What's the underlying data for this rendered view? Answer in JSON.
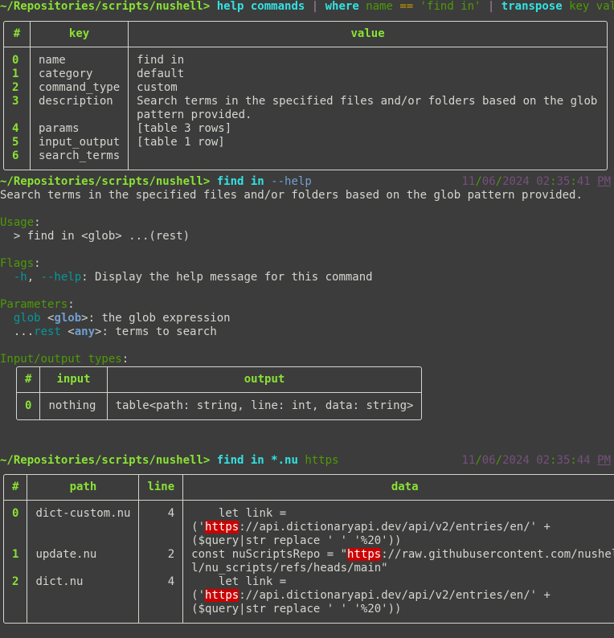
{
  "prompt": "~/Repositories/scripts/nushell>",
  "commands": [
    {
      "parts": [
        {
          "text": "help commands",
          "cls": "cmd"
        },
        {
          "text": " | ",
          "cls": "pipe"
        },
        {
          "text": "where",
          "cls": "kw"
        },
        {
          "text": " name ",
          "cls": "arg"
        },
        {
          "text": "==",
          "cls": "op"
        },
        {
          "text": " 'find in' ",
          "cls": "arg"
        },
        {
          "text": "| ",
          "cls": "pipe"
        },
        {
          "text": "transpose",
          "cls": "kw"
        },
        {
          "text": " key value",
          "cls": "arg"
        }
      ]
    },
    {
      "parts": [
        {
          "text": "find in ",
          "cls": "cmd"
        },
        {
          "text": "--help",
          "cls": "flag"
        }
      ],
      "timestamp": {
        "month": "11",
        "day": "06",
        "year": "2024",
        "h": "02",
        "m": "35",
        "s": "41",
        "ampm": "PM"
      }
    },
    {
      "parts": [
        {
          "text": "find in *.nu ",
          "cls": "cmd"
        },
        {
          "text": "https",
          "cls": "arg"
        }
      ],
      "timestamp": {
        "month": "11",
        "day": "06",
        "year": "2024",
        "h": "02",
        "m": "35",
        "s": "44",
        "ampm": "PM"
      }
    }
  ],
  "transpose_table": {
    "headers": [
      "#",
      "key",
      "value"
    ],
    "rows": [
      {
        "idx": "0",
        "key": "name",
        "value": "find in"
      },
      {
        "idx": "1",
        "key": "category",
        "value": "default"
      },
      {
        "idx": "2",
        "key": "command_type",
        "value": "custom"
      },
      {
        "idx": "3",
        "key": "description",
        "value": "Search terms in the specified files and/or folders based on the glob\npattern provided."
      },
      {
        "idx": "4",
        "key": "params",
        "value": "[table 3 rows]"
      },
      {
        "idx": "5",
        "key": "input_output",
        "value": "[table 1 row]"
      },
      {
        "idx": "6",
        "key": "search_terms",
        "value": ""
      }
    ]
  },
  "help": {
    "description": "Search terms in the specified files and/or folders based on the glob pattern provided.",
    "usage_header": "Usage",
    "usage_line": "  > find in <glob> ...(rest)",
    "flags_header": "Flags",
    "flag_short": "-h",
    "flag_long": "--help",
    "flag_desc": ": Display the help message for this command",
    "params_header": "Parameters",
    "param1_name": "glob",
    "param1_type": "glob",
    "param1_desc": ": the glob expression",
    "param2_prefix": "...",
    "param2_name": "rest",
    "param2_type": "any",
    "param2_desc": ": terms to search",
    "io_header": "Input/output types",
    "io_table": {
      "headers": [
        "#",
        "input",
        "output"
      ],
      "rows": [
        {
          "idx": "0",
          "input": "nothing",
          "output": "table<path: string, line: int, data: string>"
        }
      ]
    }
  },
  "find_table": {
    "headers": [
      "#",
      "path",
      "line",
      "data"
    ],
    "rows": [
      {
        "idx": "0",
        "path": "dict-custom.nu",
        "line": "4",
        "data": [
          [
            "    let link = "
          ],
          [
            "('",
            {
              "hl": "https"
            },
            "://api.dictionaryapi.dev/api/v2/entries/en/' +"
          ],
          [
            "($query|str replace ' ' '%20'))"
          ]
        ]
      },
      {
        "idx": "1",
        "path": "update.nu",
        "line": "2",
        "data": [
          [
            "const nuScriptsRepo = \"",
            {
              "hl": "https"
            },
            "://raw.githubusercontent.com/nushel"
          ],
          [
            "l/nu_scripts/refs/heads/main\""
          ]
        ]
      },
      {
        "idx": "2",
        "path": "dict.nu",
        "line": "4",
        "data": [
          [
            "    let link = "
          ],
          [
            "('",
            {
              "hl": "https"
            },
            "://api.dictionaryapi.dev/api/v2/entries/en/' +"
          ],
          [
            "($query|str replace ' ' '%20'))"
          ]
        ]
      }
    ]
  }
}
